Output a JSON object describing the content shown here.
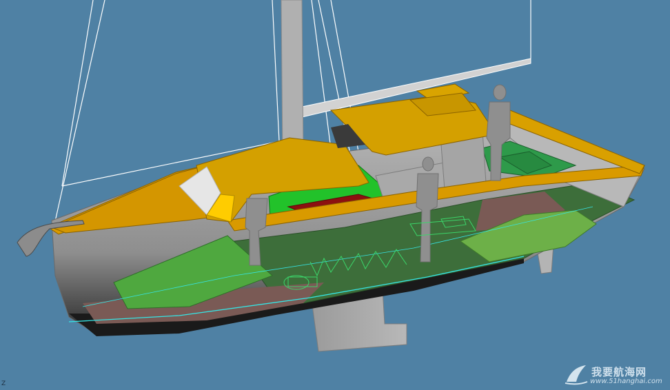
{
  "viewport": {
    "background": "#4f81a4",
    "axis_label": "Z"
  },
  "model": {
    "subject": "sailboat-3d-cutaway",
    "colors": {
      "hull": "#9c9c9c",
      "deck_trim": "#d99a00",
      "cabin_top": "#d4a000",
      "window": "#e6e6e6",
      "interior_floor": "#3d6e3a",
      "bunk_pads": "#4fa83f",
      "cockpit_seats": "#2e9a4a",
      "cushions": "#22c22a",
      "table": "#8c1010",
      "bilge": "#7a5a55",
      "keel": "#a0a0a0",
      "waterline": "#35e6e6",
      "rigging": "#ffffff",
      "figures": "#8f8f8f"
    }
  },
  "watermark": {
    "cn_text": "我要航海网",
    "url": "www.51hanghai.com",
    "logo": "sail-logo-icon"
  }
}
